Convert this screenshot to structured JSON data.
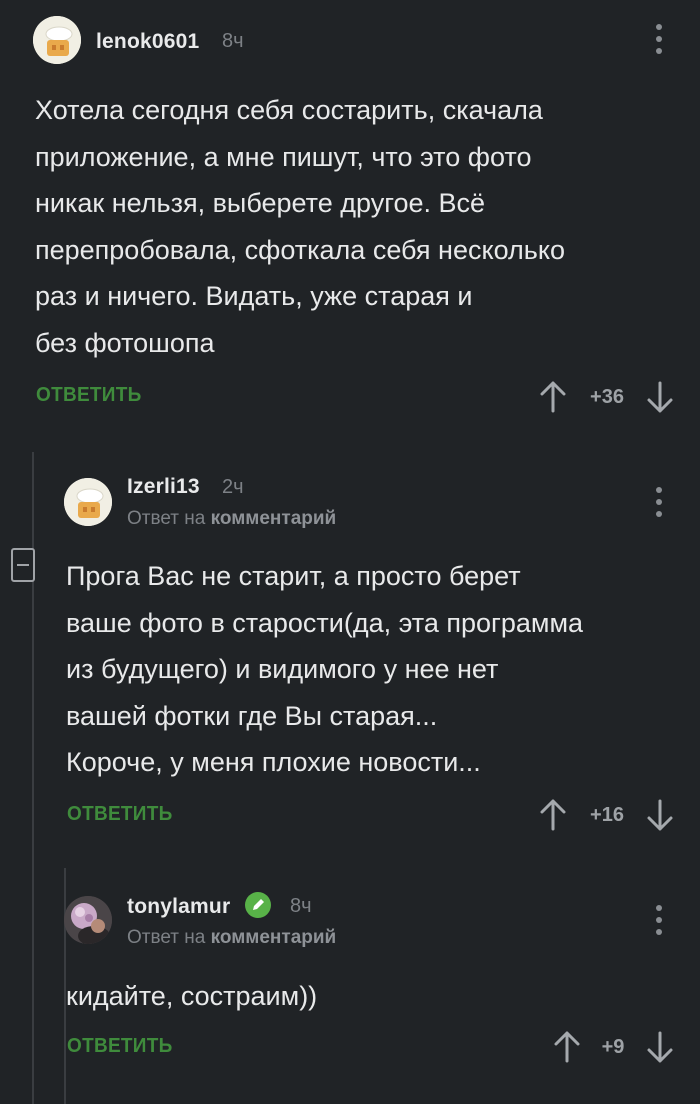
{
  "comments": [
    {
      "username": "lenok0601",
      "time": "8ч",
      "text_lines": [
        "Хотела сегодня себя состарить, скачала",
        "приложение, а мне пишут, что это фото",
        "никак нельзя, выберете другое. Всё",
        "перепробовала, сфоткала себя несколько",
        "раз и ничего. Видать, уже старая и",
        "без фотошопа"
      ],
      "reply_label": "ОТВЕТИТЬ",
      "score": "+36"
    },
    {
      "username": "Izerli13",
      "time": "2ч",
      "reply_to_prefix": "Ответ на",
      "reply_to_target": "комментарий",
      "text_lines": [
        "Прога Вас не старит, а просто берет",
        "ваше фото в старости(да, эта программа",
        "из будущего) и видимого у нее нет",
        "вашей фотки где Вы старая...",
        "Короче, у меня плохие новости..."
      ],
      "reply_label": "ОТВЕТИТЬ",
      "score": "+16"
    },
    {
      "username": "tonylamur",
      "time": "8ч",
      "reply_to_prefix": "Ответ на",
      "reply_to_target": "комментарий",
      "text_lines": [
        "кидайте, состраим))"
      ],
      "reply_label": "ОТВЕТИТЬ",
      "score": "+9"
    }
  ],
  "colors": {
    "background": "#202326",
    "reply_green": "#3f8b3c",
    "verified_green": "#58b248"
  },
  "icons": {
    "more": "more-vertical-icon",
    "upvote": "arrow-up-icon",
    "downvote": "arrow-down-icon",
    "collapse": "minus-square-icon",
    "verified": "pencil-badge-icon"
  }
}
